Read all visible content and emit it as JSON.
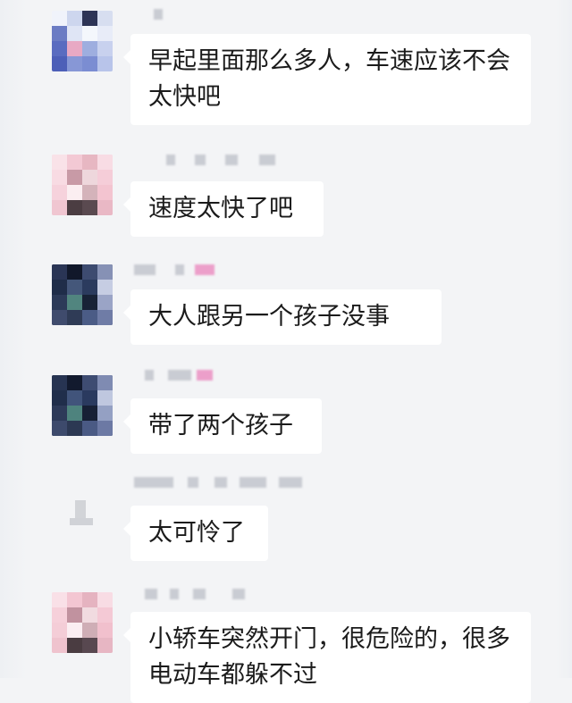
{
  "messages": [
    {
      "text": "早起里面那么多人，车速应该不会太快吧"
    },
    {
      "text": "速度太快了吧"
    },
    {
      "text": "大人跟另一个孩子没事"
    },
    {
      "text": "带了两个孩子"
    },
    {
      "text": "太可怜了"
    },
    {
      "text": "小轿车突然开门，很危险的，很多电动车都躲不过"
    }
  ]
}
